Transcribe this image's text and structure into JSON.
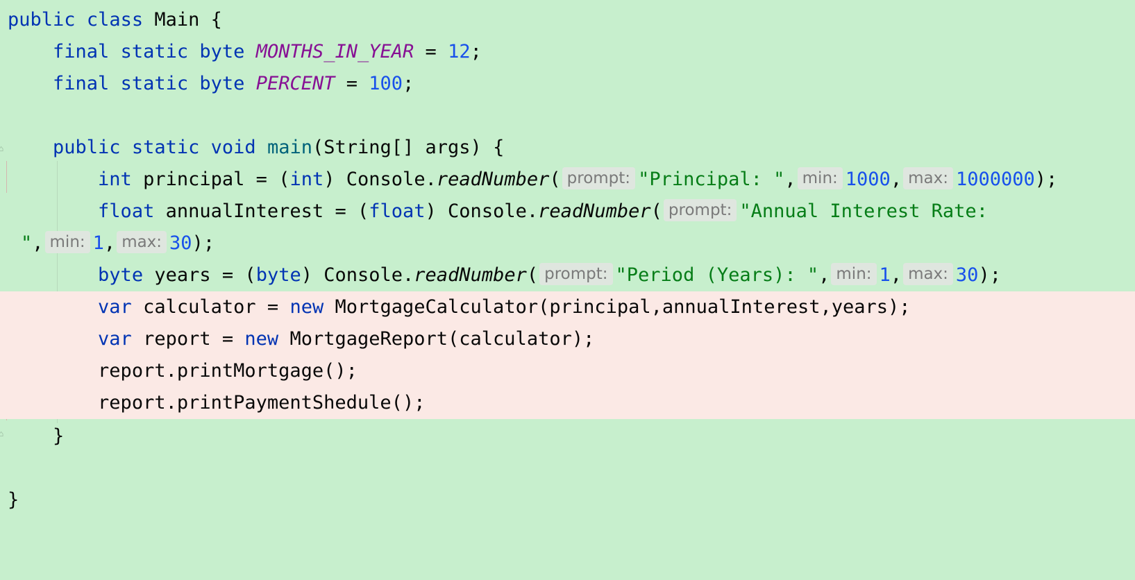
{
  "editor": {
    "colors": {
      "background": "#c7efcd",
      "deleted_background": "#fbe9e5",
      "keyword": "#0033b3",
      "constant": "#871094",
      "number": "#1750eb",
      "string": "#067d17",
      "method_decl": "#00627a",
      "hint": "#7a7a7a"
    },
    "lines": {
      "l1": {
        "kw1": "public",
        "kw2": "class",
        "name": "Main",
        "brace": "{"
      },
      "l2": {
        "kw1": "final",
        "kw2": "static",
        "kw3": "byte",
        "const": "MONTHS_IN_YEAR",
        "eq": "=",
        "num": "12",
        "end": ";"
      },
      "l3": {
        "kw1": "final",
        "kw2": "static",
        "kw3": "byte",
        "const": "PERCENT",
        "eq": "=",
        "num": "100",
        "end": ";"
      },
      "l5": {
        "kw1": "public",
        "kw2": "static",
        "kw3": "void",
        "fn": "main",
        "params": "(String[] args)",
        "brace": "{"
      },
      "l6": {
        "type": "int",
        "var": "principal",
        "eq": "=",
        "cast_open": "(",
        "cast": "int",
        "cast_close": ")",
        "recv": "Console.",
        "method": "readNumber",
        "paren": "(",
        "hint_prompt": "prompt:",
        "str": "\"Principal: \"",
        "comma1": ",",
        "hint_min": "min:",
        "min": "1000",
        "comma2": ",",
        "hint_max": "max:",
        "max": "1000000",
        "end": ");"
      },
      "l7": {
        "type": "float",
        "var": "annualInterest",
        "eq": "=",
        "cast_open": "(",
        "cast": "float",
        "cast_close": ")",
        "recv": "Console.",
        "method": "readNumber",
        "paren": "(",
        "hint_prompt": "prompt:",
        "str": "\"Annual Interest Rate:"
      },
      "l8": {
        "str": "\"",
        "comma1": ",",
        "hint_min": "min:",
        "min": "1",
        "comma2": ",",
        "hint_max": "max:",
        "max": "30",
        "end": ");"
      },
      "l9": {
        "type": "byte",
        "var": "years",
        "eq": "=",
        "cast_open": "(",
        "cast": "byte",
        "cast_close": ")",
        "recv": "Console.",
        "method": "readNumber",
        "paren": "(",
        "hint_prompt": "prompt:",
        "str": "\"Period (Years): \"",
        "comma1": ",",
        "hint_min": "min:",
        "min": "1",
        "comma2": ",",
        "hint_max": "max:",
        "max": "30",
        "end": ");"
      },
      "l10": {
        "kw": "var",
        "rest1": "calculator =",
        "kw_new": "new",
        "rest2": "MortgageCalculator(principal,annualInterest,years);"
      },
      "l11": {
        "kw": "var",
        "rest1": "report =",
        "kw_new": "new",
        "rest2": "MortgageReport(calculator);"
      },
      "l12": {
        "text": "report.printMortgage();"
      },
      "l13": {
        "text": "report.printPaymentShedule();"
      },
      "l14": {
        "brace": "}"
      },
      "l16": {
        "brace": "}"
      }
    }
  }
}
